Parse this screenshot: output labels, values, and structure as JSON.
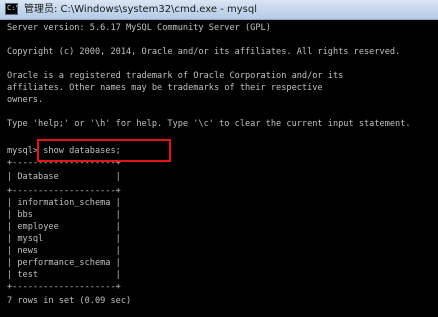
{
  "window": {
    "title": "管理员: C:\\Windows\\system32\\cmd.exe - mysql",
    "icon_text": "C:\\"
  },
  "console": {
    "lines": [
      "Server version: 5.6.17 MySQL Community Server (GPL)",
      "",
      "Copyright (c) 2000, 2014, Oracle and/or its affiliates. All rights reserved.",
      "",
      "Oracle is a registered trademark of Oracle Corporation and/or its",
      "affiliates. Other names may be trademarks of their respective",
      "owners.",
      "",
      "Type 'help;' or '\\h' for help. Type '\\c' to clear the current input statement.",
      "",
      "mysql> show databases;",
      "+--------------------+",
      "| Database           |",
      "+--------------------+",
      "| information_schema |",
      "| bbs                |",
      "| employee           |",
      "| mysql              |",
      "| news               |",
      "| performance_schema |",
      "| test               |",
      "+--------------------+",
      "7 rows in set (0.09 sec)"
    ]
  },
  "annotation": {
    "highlight_color": "#e0141a"
  }
}
